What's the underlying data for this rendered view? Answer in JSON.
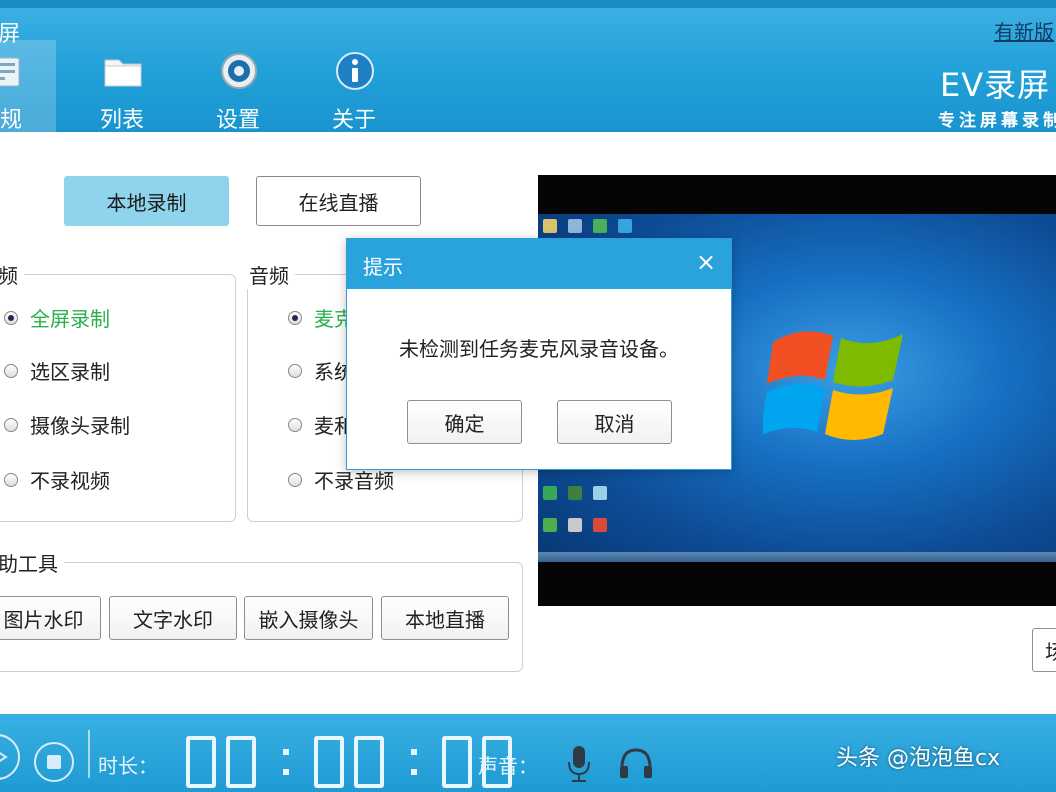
{
  "header": {
    "app_title": "屏",
    "new_version": "有新版",
    "brand": "EV录屏",
    "slogan": "专注屏幕录制",
    "tabs": [
      {
        "label": "常规",
        "icon": "general-icon"
      },
      {
        "label": "列表",
        "icon": "folder-icon"
      },
      {
        "label": "设置",
        "icon": "gear-icon"
      },
      {
        "label": "关于",
        "icon": "info-icon"
      }
    ]
  },
  "mode": {
    "local_label": "本地录制",
    "online_label": "在线直播",
    "selected": "本地录制"
  },
  "video_group": {
    "legend": "频",
    "options": [
      "全屏录制",
      "选区录制",
      "摄像头录制",
      "不录视频"
    ],
    "selected_index": 0
  },
  "audio_group": {
    "legend": "音频",
    "options": [
      "麦克",
      "系统",
      "麦和",
      "不录音频"
    ],
    "selected_index": 0
  },
  "tools_group": {
    "legend": "助工具",
    "buttons": [
      "图片水印",
      "文字水印",
      "嵌入摄像头",
      "本地直播"
    ]
  },
  "side_button_label": "场",
  "dialog": {
    "title": "提示",
    "close_glyph": "×",
    "message": "未检测到任务麦克风录音设备。",
    "ok_label": "确定",
    "cancel_label": "取消"
  },
  "bottom_bar": {
    "duration_label": "时长：",
    "sound_label": "声音：",
    "timer": "00:00:00"
  },
  "watermark": "头条 @泡泡鱼cx",
  "colors": {
    "header_blue": "#22a0d8",
    "selected_mode": "#8fd4ec",
    "selected_option": "#29b04e",
    "dialog_title": "#2aa3dc"
  }
}
